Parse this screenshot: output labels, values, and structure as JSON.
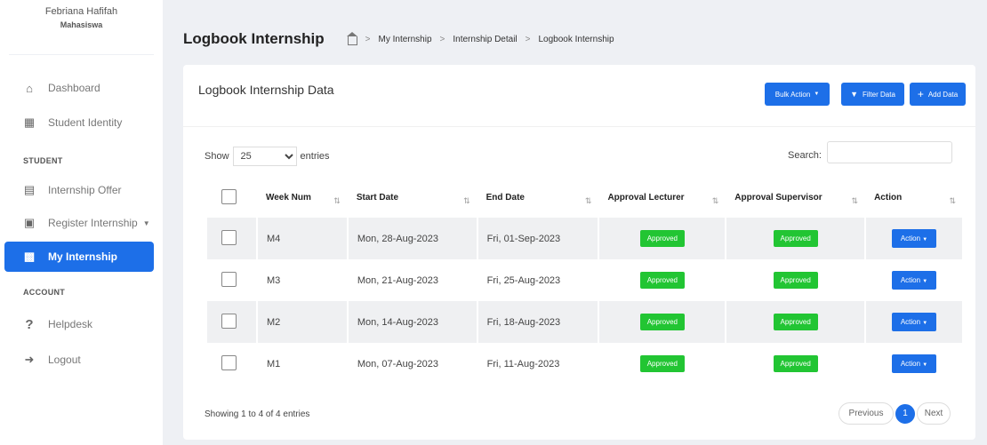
{
  "user": {
    "name": "Febriana Hafifah",
    "role": "Mahasiswa"
  },
  "sidebar": {
    "items": [
      {
        "label": "Dashboard",
        "icon": "home-icon"
      },
      {
        "label": "Student Identity",
        "icon": "id-card-icon"
      },
      {
        "section": "STUDENT"
      },
      {
        "label": "Internship Offer",
        "icon": "clipboard-icon"
      },
      {
        "label": "Register Internship",
        "icon": "calendar-icon"
      },
      {
        "label": "My Internship",
        "icon": "briefcase-icon"
      },
      {
        "section": "ACCOUNT"
      },
      {
        "label": "Helpdesk",
        "icon": "question-icon"
      },
      {
        "label": "Logout",
        "icon": "logout-icon"
      }
    ]
  },
  "header": {
    "title": "Logbook Internship",
    "breadcrumb": [
      "My Internship",
      "Internship Detail",
      "Logbook Internship"
    ]
  },
  "card": {
    "title": "Logbook Internship Data",
    "bulk_action": "Bulk Action",
    "filter": "Filter Data",
    "add": "Add Data"
  },
  "controls": {
    "show_label": "Show",
    "entries_value": "25",
    "entries_label": "entries",
    "search_label": "Search:"
  },
  "table": {
    "columns": [
      "Week Num",
      "Start Date",
      "End Date",
      "Approval Lecturer",
      "Approval Supervisor",
      "Action"
    ],
    "rows": [
      {
        "week": "M4",
        "start": "Mon, 28-Aug-2023",
        "end": "Fri, 01-Sep-2023",
        "lecturer": "Approved",
        "supervisor": "Approved",
        "action": "Action"
      },
      {
        "week": "M3",
        "start": "Mon, 21-Aug-2023",
        "end": "Fri, 25-Aug-2023",
        "lecturer": "Approved",
        "supervisor": "Approved",
        "action": "Action"
      },
      {
        "week": "M2",
        "start": "Mon, 14-Aug-2023",
        "end": "Fri, 18-Aug-2023",
        "lecturer": "Approved",
        "supervisor": "Approved",
        "action": "Action"
      },
      {
        "week": "M1",
        "start": "Mon, 07-Aug-2023",
        "end": "Fri, 11-Aug-2023",
        "lecturer": "Approved",
        "supervisor": "Approved",
        "action": "Action"
      }
    ]
  },
  "footer": {
    "info": "Showing 1 to 4 of 4 entries",
    "previous": "Previous",
    "page": "1",
    "next": "Next"
  },
  "colors": {
    "primary": "#1d6fe8",
    "success": "#22c533"
  }
}
